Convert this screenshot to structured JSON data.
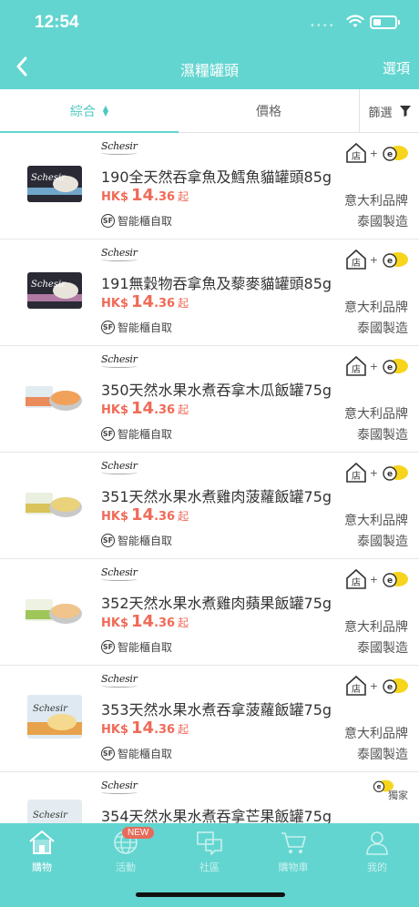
{
  "status_bar": {
    "time": "12:54"
  },
  "header": {
    "title": "濕糧罐頭",
    "options_label": "選項"
  },
  "sort_bar": {
    "general_label": "綜合",
    "price_label": "價格",
    "filter_label": "篩選"
  },
  "products": [
    {
      "brand": "Schesir",
      "name": "190全天然吞拿魚及鱈魚貓罐頭85g",
      "currency": "HK$",
      "price_main": "14",
      "price_decimal": ".36",
      "price_suffix": "起",
      "pickup": "智能櫃自取",
      "store_label": "店",
      "origin_brand": "意大利品牌",
      "origin_country": "泰國製造",
      "image_style": "dark-can"
    },
    {
      "brand": "Schesir",
      "name": "191無穀物吞拿魚及藜麥貓罐頭85g",
      "currency": "HK$",
      "price_main": "14",
      "price_decimal": ".36",
      "price_suffix": "起",
      "pickup": "智能櫃自取",
      "store_label": "店",
      "origin_brand": "意大利品牌",
      "origin_country": "泰國製造",
      "image_style": "dark-can"
    },
    {
      "brand": "Schesir",
      "name": "350天然水果水煮吞拿木瓜飯罐75g",
      "currency": "HK$",
      "price_main": "14",
      "price_decimal": ".36",
      "price_suffix": "起",
      "pickup": "智能櫃自取",
      "store_label": "店",
      "origin_brand": "意大利品牌",
      "origin_country": "泰國製造",
      "image_style": "fruit-can"
    },
    {
      "brand": "Schesir",
      "name": "351天然水果水煮雞肉菠蘿飯罐75g",
      "currency": "HK$",
      "price_main": "14",
      "price_decimal": ".36",
      "price_suffix": "起",
      "pickup": "智能櫃自取",
      "store_label": "店",
      "origin_brand": "意大利品牌",
      "origin_country": "泰國製造",
      "image_style": "fruit-can"
    },
    {
      "brand": "Schesir",
      "name": "352天然水果水煮雞肉蘋果飯罐75g",
      "currency": "HK$",
      "price_main": "14",
      "price_decimal": ".36",
      "price_suffix": "起",
      "pickup": "智能櫃自取",
      "store_label": "店",
      "origin_brand": "意大利品牌",
      "origin_country": "泰國製造",
      "image_style": "fruit-can"
    },
    {
      "brand": "Schesir",
      "name": "353天然水果水煮吞拿菠蘿飯罐75g",
      "currency": "HK$",
      "price_main": "14",
      "price_decimal": ".36",
      "price_suffix": "起",
      "pickup": "智能櫃自取",
      "store_label": "店",
      "origin_brand": "意大利品牌",
      "origin_country": "泰國製造",
      "image_style": "box-can"
    }
  ],
  "partial_product": {
    "brand": "Schesir",
    "name": "354天然水果水煮吞拿芒果飯罐75g",
    "exclusive_label": "獨家"
  },
  "tab_bar": {
    "new_badge": "NEW",
    "tabs": [
      {
        "label": "購物",
        "icon": "home-icon",
        "active": true
      },
      {
        "label": "活動",
        "icon": "globe-icon",
        "active": false
      },
      {
        "label": "社區",
        "icon": "chat-icon",
        "active": false
      },
      {
        "label": "購物車",
        "icon": "cart-icon",
        "active": false
      },
      {
        "label": "我的",
        "icon": "user-icon",
        "active": false
      }
    ]
  },
  "colors": {
    "brand": "#63d5d0",
    "price": "#f06a58",
    "new_badge": "#e66b5b",
    "badge_yellow": "#f7d51d"
  }
}
